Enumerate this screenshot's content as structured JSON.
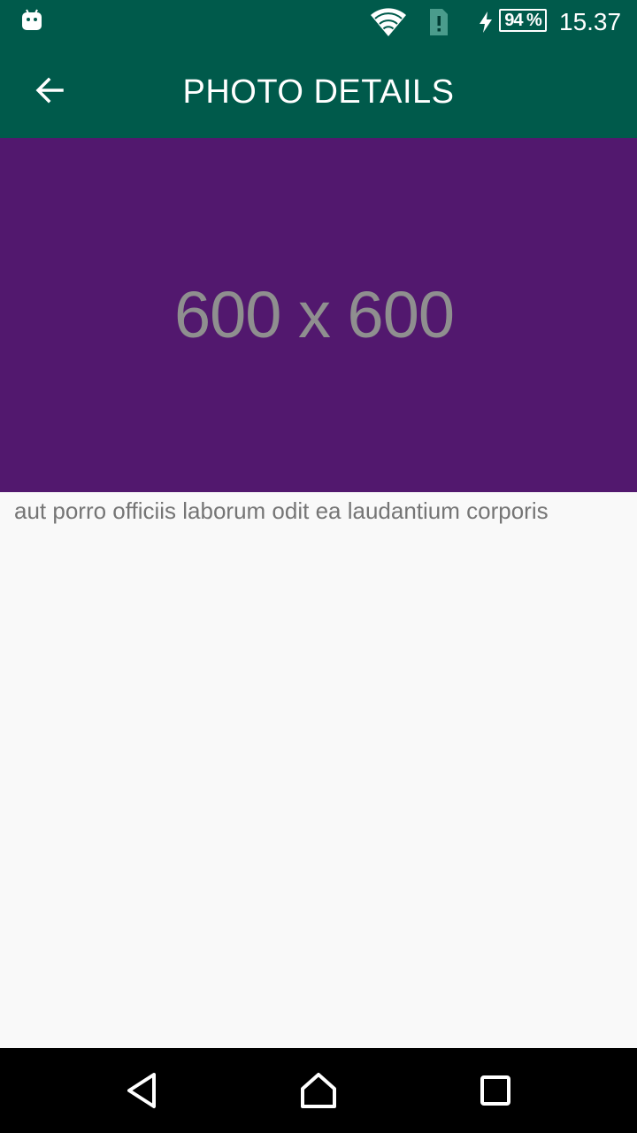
{
  "status_bar": {
    "time": "15.37",
    "battery_percent": "94 %",
    "icons": [
      "android-icon",
      "wifi-icon",
      "sim-alert-icon",
      "charging-icon",
      "battery-icon"
    ]
  },
  "app_bar": {
    "title": "PHOTO DETAILS",
    "back_icon": "arrow-back-icon"
  },
  "photo": {
    "placeholder_text": "600 x 600",
    "background_color": "#52186e",
    "text_color": "#8f8f8f"
  },
  "caption": "aut porro officiis laborum odit ea laudantium corporis",
  "nav_bar": {
    "icons": [
      "back-triangle-icon",
      "home-icon",
      "recents-square-icon"
    ]
  },
  "colors": {
    "primary_dark": "#005a4b",
    "background": "#f9f9f9",
    "caption_text": "#757575"
  }
}
